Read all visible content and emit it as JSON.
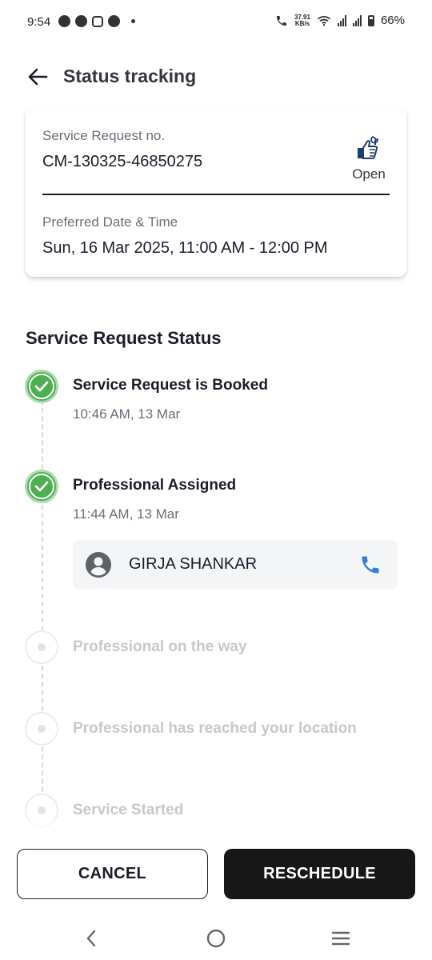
{
  "status_bar": {
    "time": "9:54",
    "net_speed_top": "37.91",
    "net_speed_bottom": "KB/s",
    "battery": "66%"
  },
  "header": {
    "title": "Status tracking"
  },
  "request_card": {
    "sr_label": "Service Request no.",
    "sr_value": "CM-130325-46850275",
    "status_label": "Open",
    "preferred_label": "Preferred Date & Time",
    "preferred_value": "Sun, 16 Mar 2025, 11:00 AM - 12:00 PM"
  },
  "status_section": {
    "title": "Service Request Status",
    "steps": [
      {
        "title": "Service Request is Booked",
        "time": "10:46 AM, 13 Mar",
        "state": "done"
      },
      {
        "title": "Professional Assigned",
        "time": "11:44 AM, 13 Mar",
        "state": "done"
      },
      {
        "title": "Professional on the way",
        "state": "pending"
      },
      {
        "title": "Professional has reached your location",
        "state": "pending"
      },
      {
        "title": "Service Started",
        "state": "pending"
      }
    ],
    "professional": {
      "name": "GIRJA SHANKAR"
    }
  },
  "actions": {
    "cancel_label": "CANCEL",
    "reschedule_label": "RESCHEDULE"
  },
  "colors": {
    "success": "#4caf50",
    "phone": "#2f7fe0",
    "primary_button": "#171717"
  }
}
